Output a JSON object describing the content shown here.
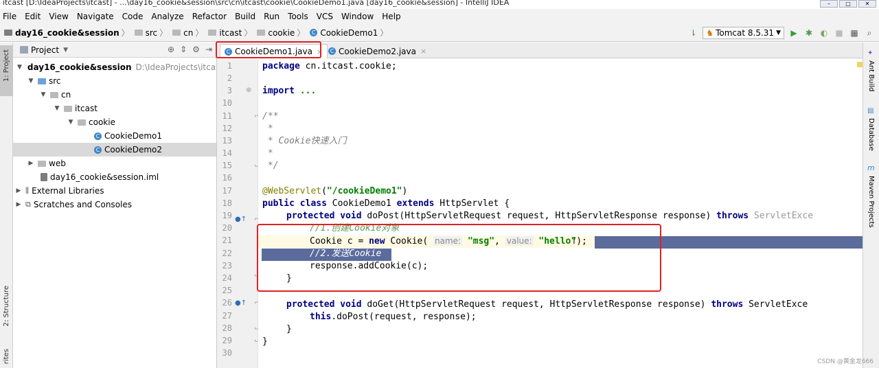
{
  "window": {
    "title": "itcast [D:\\IdeaProjects\\itcast] - ...\\day16_cookie&session\\src\\cn\\itcast\\cookie\\CookieDemo1.java [day16_cookie&session] - IntelliJ IDEA"
  },
  "menu": [
    "File",
    "Edit",
    "View",
    "Navigate",
    "Code",
    "Analyze",
    "Refactor",
    "Build",
    "Run",
    "Tools",
    "VCS",
    "Window",
    "Help"
  ],
  "breadcrumb": [
    "day16_cookie&session",
    "src",
    "cn",
    "itcast",
    "cookie",
    "CookieDemo1"
  ],
  "run_config": "Tomcat 8.5.31",
  "left_stripe": {
    "project": "1: Project",
    "structure": "2: Structure",
    "favorites": "rites"
  },
  "right_stripe": {
    "ant": "Ant Build",
    "database": "Database",
    "maven": "Maven Projects"
  },
  "project_panel": {
    "title": "Project",
    "tree": [
      {
        "label": "day16_cookie&session",
        "path": "D:\\IdeaProjects\\itcast"
      },
      {
        "label": "src"
      },
      {
        "label": "cn"
      },
      {
        "label": "itcast"
      },
      {
        "label": "cookie"
      },
      {
        "label": "CookieDemo1"
      },
      {
        "label": "CookieDemo2"
      },
      {
        "label": "web"
      },
      {
        "label": "day16_cookie&session.iml"
      },
      {
        "label": "External Libraries"
      },
      {
        "label": "Scratches and Consoles"
      }
    ]
  },
  "tabs": [
    {
      "label": "CookieDemo1.java",
      "active": true
    },
    {
      "label": "CookieDemo2.java",
      "active": false
    }
  ],
  "line_numbers": [
    "1",
    "2",
    "3",
    "10",
    "11",
    "12",
    "13",
    "14",
    "15",
    "16",
    "17",
    "18",
    "19",
    "20",
    "21",
    "22",
    "23",
    "24",
    "25",
    "26",
    "27",
    "28",
    "29",
    "30"
  ],
  "code": {
    "l1_kw": "package",
    "l1_rest": " cn.itcast.cookie;",
    "l3_kw": "import",
    "l3_rest": " ...",
    "l10": "/**",
    "l11": " *",
    "l12": " * Cookie快速入门",
    "l13": " *",
    "l14": " */",
    "l16_ann": "@WebServlet",
    "l16_p1": "(",
    "l16_str": "\"/cookieDemo1\"",
    "l16_p2": ")",
    "l17_kw1": "public class",
    "l17_name": " CookieDemo1 ",
    "l17_kw2": "extends",
    "l17_rest": " HttpServlet {",
    "l18_kw1": "protected void",
    "l18_rest": " doPost(HttpServletRequest request, HttpServletResponse response) ",
    "l18_kw2": "throws",
    "l18_dim": " ServletExce",
    "l19_cmt": "//1.创建Cookie对象",
    "l20_a": "Cookie c = ",
    "l20_kw": "new",
    "l20_b": " Cookie( ",
    "l20_h1": "name:",
    "l20_s1": "\"msg\"",
    "l20_c": ", ",
    "l20_h2": "value:",
    "l20_s2": "\"hello\"",
    "l20_d": ");",
    "l21_cmt": "//2.发送Cookie",
    "l22": "response.addCookie(c);",
    "l23": "}",
    "l25_kw1": "protected void",
    "l25_rest": " doGet(HttpServletRequest request, HttpServletResponse response) ",
    "l25_kw2": "throws",
    "l25_rest2": " ServletExce",
    "l26_kw": "this",
    "l26_rest": ".doPost(request, response);",
    "l27": "}",
    "l28": "}"
  },
  "watermark": "CSDN @黄金龙666"
}
